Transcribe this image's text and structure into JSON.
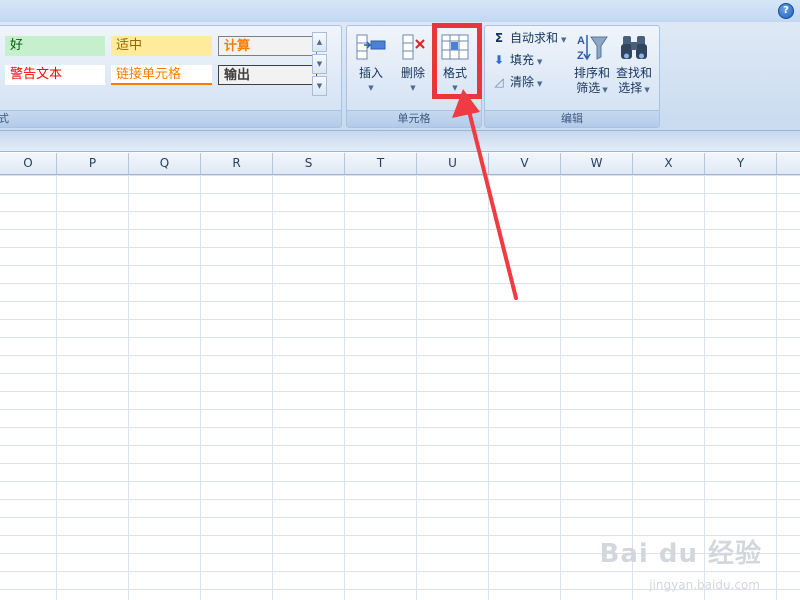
{
  "help_label": "?",
  "ribbon": {
    "styles_group": {
      "label": "样式",
      "cells": [
        {
          "text": "好",
          "bg": "#c6efce",
          "color": "#006100"
        },
        {
          "text": "适中",
          "bg": "#ffeb9c",
          "color": "#9c6500"
        },
        {
          "text": "计算",
          "bg": "#f2f2f2",
          "color": "#fa7d00"
        },
        {
          "text": "警告文本",
          "bg": "#ffffff",
          "color": "#ff0000"
        },
        {
          "text": "链接单元格",
          "bg": "#ffffff",
          "color": "#fa7d00"
        },
        {
          "text": "输出",
          "bg": "#f2f2f2",
          "color": "#3f3f3f"
        }
      ]
    },
    "cells_group": {
      "label": "单元格",
      "insert": "插入",
      "delete": "删除",
      "format": "格式"
    },
    "editing_group": {
      "label": "编辑",
      "autosum": "自动求和",
      "fill": "填充",
      "clear": "清除",
      "sort_filter": [
        "排序和",
        "筛选"
      ],
      "find_select": [
        "查找和",
        "选择"
      ]
    }
  },
  "columns": [
    "O",
    "P",
    "Q",
    "R",
    "S",
    "T",
    "U",
    "V",
    "W",
    "X",
    "Y"
  ],
  "watermark": {
    "main": "Bai du 经验",
    "sub": "jingyan.baidu.com"
  },
  "colors": {
    "accent": "#e8363c",
    "ribbon": "#dfe9f5",
    "grid": "#dae2ec"
  }
}
